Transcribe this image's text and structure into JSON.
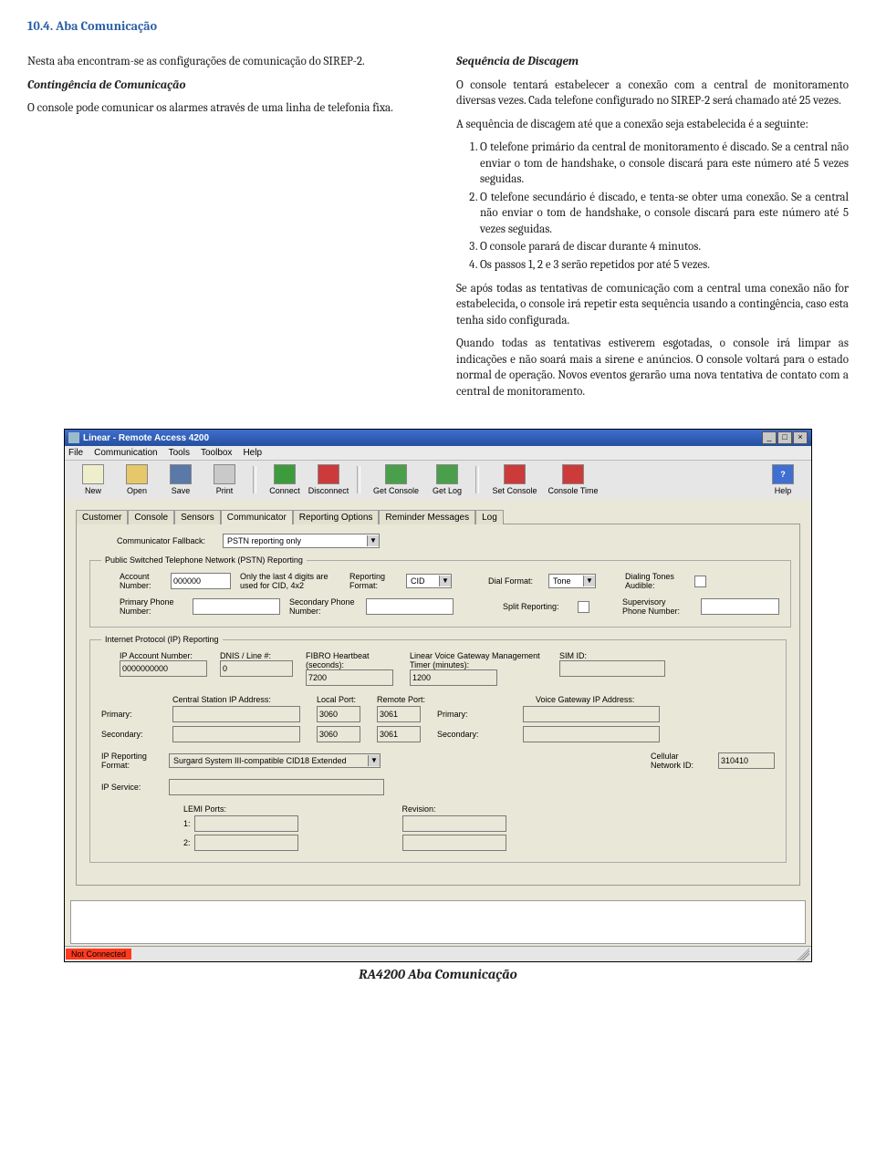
{
  "doc": {
    "heading": "10.4.  Aba Comunicação",
    "leftCol": {
      "p1": "Nesta aba encontram-se as configurações de comunicação do SIREP-2.",
      "sub1Title": "Contingência de Comunicação",
      "sub1Text": "O console pode comunicar os alarmes através de uma linha de telefonia fixa."
    },
    "rightCol": {
      "sub1Title": "Sequência de Discagem",
      "p1": "O console tentará estabelecer a conexão com a central de monitoramento diversas vezes. Cada telefone configurado no SIREP-2  será chamado até 25 vezes.",
      "p2": "A sequência de discagem até que a conexão seja estabelecida é a seguinte:",
      "li1": "O telefone primário da central de monitoramento é discado. Se a central não enviar o tom de handshake, o console discará para este número até 5 vezes seguidas.",
      "li2": "O telefone secundário é discado, e tenta-se obter uma conexão. Se a central não enviar o tom de handshake, o console discará para este número até 5 vezes seguidas.",
      "li3": "O console parará de discar durante  4 minutos.",
      "li4": "Os passos 1, 2 e 3 serão repetidos por até 5 vezes.",
      "p3": "Se após todas as tentativas de comunicação com a central uma conexão não for estabelecida, o console irá repetir esta sequência usando a contingência, caso esta tenha sido configurada.",
      "p4": "Quando todas as tentativas estiverem esgotadas, o console irá limpar as indicações e não soará mais a sirene e anúncios. O console voltará para o estado normal de operação. Novos eventos gerarão uma nova tentativa de contato com a central de monitoramento."
    },
    "caption": "RA4200 Aba Comunicação"
  },
  "app": {
    "title": "Linear - Remote Access 4200",
    "menus": [
      "File",
      "Communication",
      "Tools",
      "Toolbox",
      "Help"
    ],
    "toolbar": [
      {
        "label": "New"
      },
      {
        "label": "Open"
      },
      {
        "label": "Save"
      },
      {
        "label": "Print"
      },
      {
        "label": "Connect"
      },
      {
        "label": "Disconnect"
      },
      {
        "label": "Get Console"
      },
      {
        "label": "Get Log"
      },
      {
        "label": "Set Console"
      },
      {
        "label": "Console Time"
      },
      {
        "label": "Help"
      }
    ],
    "tabs": [
      "Customer",
      "Console",
      "Sensors",
      "Communicator",
      "Reporting Options",
      "Reminder Messages",
      "Log"
    ],
    "fallbackLabel": "Communicator Fallback:",
    "fallbackValue": "PSTN reporting only",
    "pstnLegend": "Public Switched Telephone Network (PSTN) Reporting",
    "pstn": {
      "acctLabel": "Account Number:",
      "acctValue": "000000",
      "acctNote": "Only the last 4 digits are used for CID, 4x2",
      "repFmtLabel": "Reporting Format:",
      "repFmtValue": "CID",
      "dialFmtLabel": "Dial Format:",
      "dialFmtValue": "Tone",
      "tonesLabel": "Dialing Tones Audible:",
      "primPhoneLabel": "Primary Phone Number:",
      "secPhoneLabel": "Secondary Phone Number:",
      "splitLabel": "Split Reporting:",
      "supLabel": "Supervisory Phone Number:"
    },
    "ipLegend": "Internet Protocol (IP) Reporting",
    "ip": {
      "acctLabel": "IP Account Number:",
      "acctValue": "0000000000",
      "dnisLabel": "DNIS / Line #:",
      "dnisValue": "0",
      "fibroLabel": "FIBRO Heartbeat (seconds):",
      "fibroValue": "7200",
      "lvgLabel": "Linear Voice Gateway Management Timer (minutes):",
      "lvgValue": "1200",
      "simLabel": "SIM ID:",
      "csIpLabel": "Central Station  IP Address:",
      "localPortLabel": "Local Port:",
      "remotePortLabel": "Remote Port:",
      "vgIpLabel": "Voice Gateway  IP Address:",
      "primary": "Primary:",
      "secondary": "Secondary:",
      "lp1": "3060",
      "rp1": "3061",
      "lp2": "3060",
      "rp2": "3061",
      "ipRepFmtLabel": "IP Reporting Format:",
      "ipRepFmtValue": "Surgard System III-compatible CID18 Extended",
      "cellIdLabel": "Cellular Network ID:",
      "cellIdValue": "310410",
      "ipServiceLabel": "IP Service:",
      "lemiLabel": "LEMI Ports:",
      "revLabel": "Revision:",
      "n1": "1:",
      "n2": "2:"
    },
    "status": "Not Connected"
  }
}
